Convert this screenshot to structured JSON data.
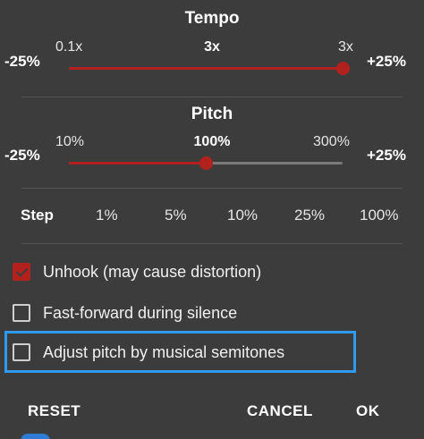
{
  "tempo": {
    "title": "Tempo",
    "minus_label": "-25%",
    "plus_label": "+25%",
    "min_tick": "0.1x",
    "current_tick": "3x",
    "max_tick": "3x",
    "value_fraction": 1.0
  },
  "pitch": {
    "title": "Pitch",
    "minus_label": "-25%",
    "plus_label": "+25%",
    "min_tick": "10%",
    "current_tick": "100%",
    "max_tick": "300%",
    "value_fraction": 0.5
  },
  "step": {
    "label": "Step",
    "options": [
      "1%",
      "5%",
      "10%",
      "25%",
      "100%"
    ]
  },
  "checkboxes": {
    "unhook": {
      "label": "Unhook (may cause distortion)",
      "checked": true
    },
    "fast_forward": {
      "label": "Fast-forward during silence",
      "checked": false
    },
    "semitones": {
      "label": "Adjust pitch by musical semitones",
      "checked": false
    }
  },
  "buttons": {
    "reset": "RESET",
    "cancel": "CANCEL",
    "ok": "OK"
  },
  "colors": {
    "accent": "#b3211e",
    "highlight": "#2e9bf0",
    "background": "#3c3c3c",
    "track_inactive": "#7a7a7a"
  }
}
